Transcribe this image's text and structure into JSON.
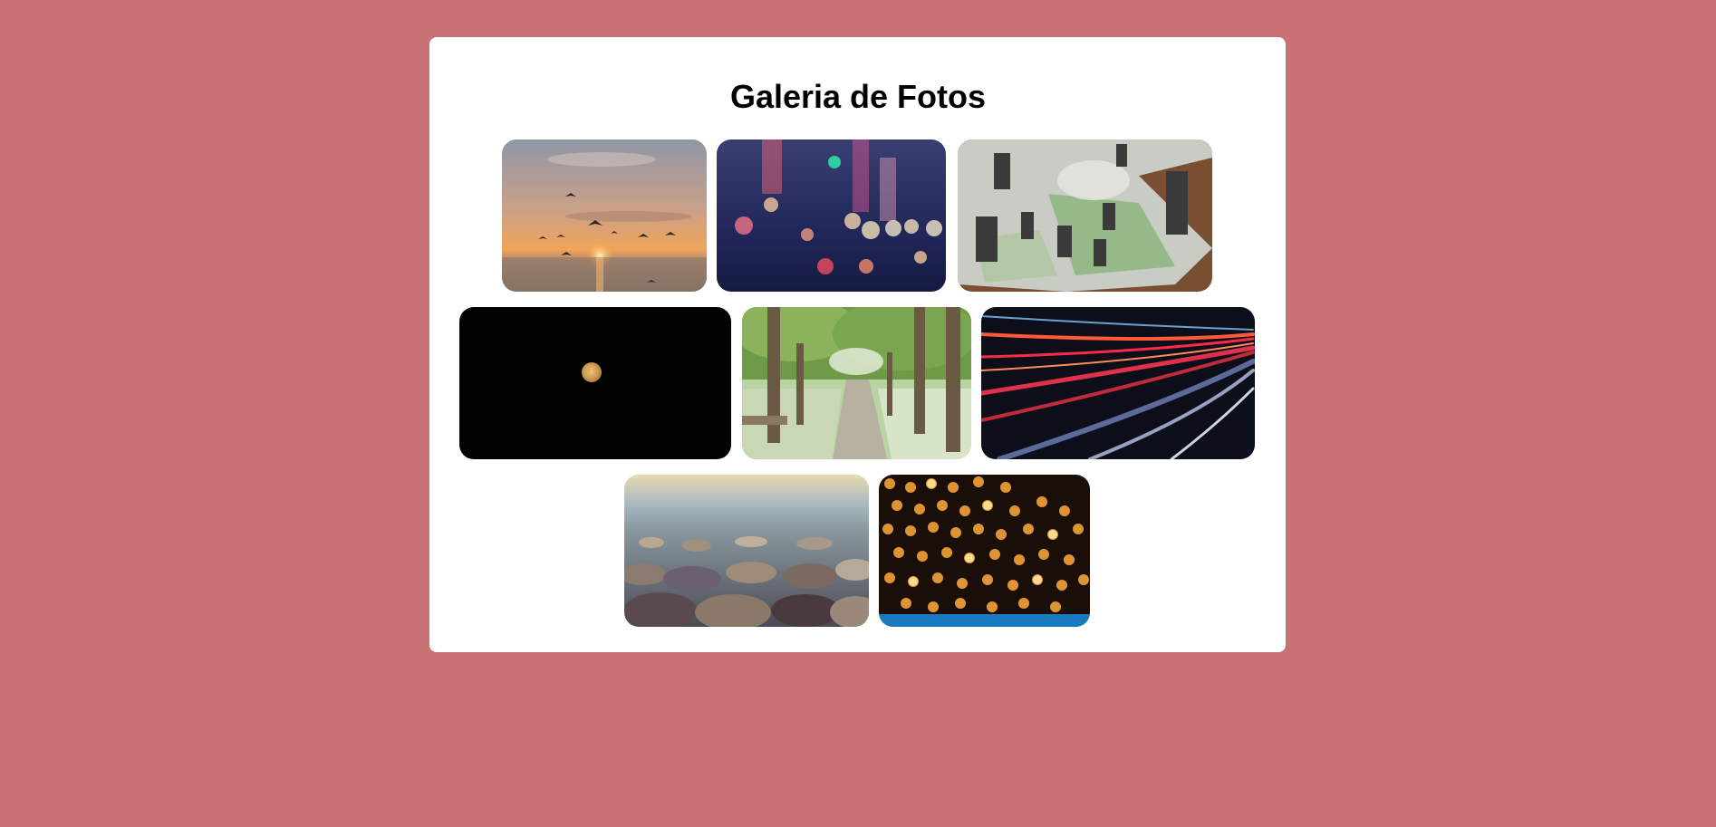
{
  "gallery": {
    "title": "Galeria de Fotos",
    "photos": [
      {
        "subject": "seagulls-sunset"
      },
      {
        "subject": "city-bokeh-night"
      },
      {
        "subject": "miniature-figures-board"
      },
      {
        "subject": "moon-night-sky"
      },
      {
        "subject": "tree-lined-park-path"
      },
      {
        "subject": "light-trails-tunnel"
      },
      {
        "subject": "pebbles-beach"
      },
      {
        "subject": "orange-bokeh-lights"
      }
    ]
  },
  "colors": {
    "page_background": "#c87275",
    "card_background": "#ffffff"
  }
}
